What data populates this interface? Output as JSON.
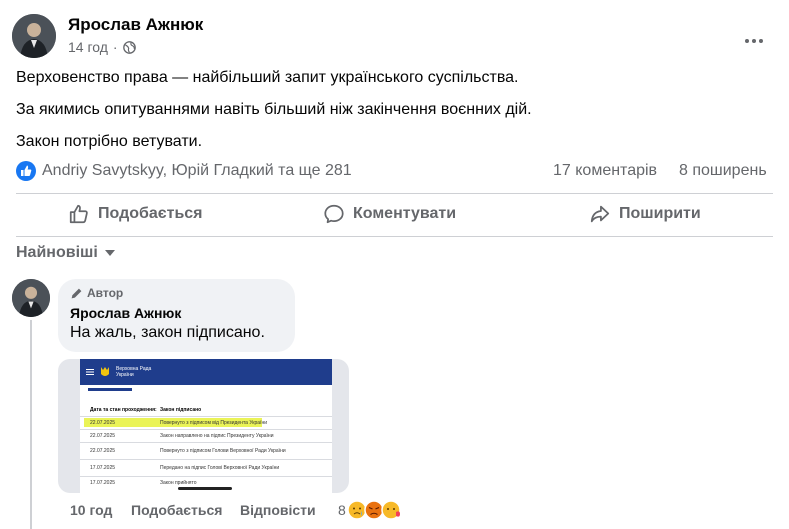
{
  "post": {
    "author": "Ярослав Ажнюк",
    "time": "14 год",
    "separator": "·",
    "lines": [
      "Верховенство права — найбільший запит українського суспільства.",
      "За якимись опитуваннями навіть більший ніж закінчення воєнних дій.",
      "Закон потрібно ветувати."
    ],
    "reactions_text": "Andriy Savytskyy, Юрій Гладкий та ще 281",
    "comments_count": "17 коментарів",
    "shares_count": "8 поширень",
    "icons": {
      "more": "more-dots-icon",
      "privacy": "globe-icon",
      "like_reaction": "like-reaction-icon"
    }
  },
  "actions": {
    "like": "Подобається",
    "comment": "Коментувати",
    "share": "Поширити"
  },
  "sort": {
    "label": "Найновіші"
  },
  "comment": {
    "badge": "Автор",
    "author": "Ярослав Ажнюк",
    "text": "На жаль, закон підписано.",
    "time": "10 год",
    "like": "Подобається",
    "reply": "Відповісти",
    "reaction_count": "8"
  },
  "attachment": {
    "header_title": "Верховна Рада\nУкраїни",
    "col_date": "Дата та стан проходження:",
    "col_status": "Закон підписано",
    "rows": [
      {
        "date": "22.07.2025",
        "text": "Повернуто з підписом від Президента України"
      },
      {
        "date": "22.07.2025",
        "text": "Закон направлено на підпис Президенту України"
      },
      {
        "date": "22.07.2025",
        "text": "Повернуто з підписом Голови Верховної Ради України"
      },
      {
        "date": "17.07.2025",
        "text": "Передано на підпис Голові Верховної Ради України"
      },
      {
        "date": "17.07.2025",
        "text": "Закон прийнято"
      }
    ]
  },
  "colors": {
    "accent": "#1877f2",
    "secondary_text": "#65676b",
    "bubble_bg": "#f0f2f5",
    "highlight": "#e6f13a",
    "doc_header": "#1f3d8c"
  }
}
